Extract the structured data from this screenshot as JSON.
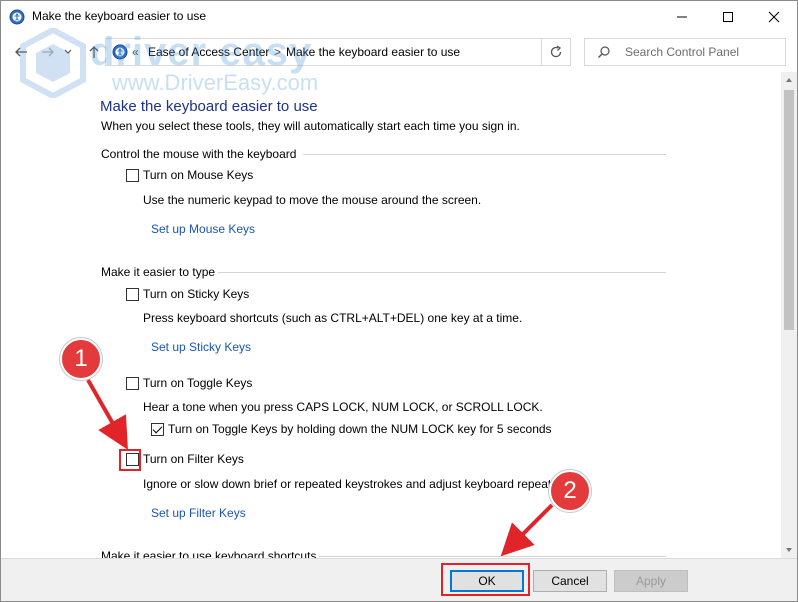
{
  "window": {
    "title": "Make the keyboard easier to use"
  },
  "nav": {
    "address_overflow": "«",
    "breadcrumbs": [
      "Ease of Access Center",
      "Make the keyboard easier to use"
    ],
    "breadcrumb_sep": ">",
    "search_placeholder": "Search Control Panel"
  },
  "page": {
    "title": "Make the keyboard easier to use",
    "subtitle": "When you select these tools, they will automatically start each time you sign in."
  },
  "sections": {
    "mouse": {
      "heading": "Control the mouse with the keyboard",
      "mouse_keys": {
        "label": "Turn on Mouse Keys",
        "checked": false
      },
      "mouse_keys_desc": "Use the numeric keypad to move the mouse around the screen.",
      "mouse_keys_link": "Set up Mouse Keys"
    },
    "typing": {
      "heading": "Make it easier to type",
      "sticky_keys": {
        "label": "Turn on Sticky Keys",
        "checked": false
      },
      "sticky_keys_desc": "Press keyboard shortcuts (such as CTRL+ALT+DEL) one key at a time.",
      "sticky_keys_link": "Set up Sticky Keys",
      "toggle_keys": {
        "label": "Turn on Toggle Keys",
        "checked": false
      },
      "toggle_keys_desc": "Hear a tone when you press CAPS LOCK, NUM LOCK, or SCROLL LOCK.",
      "toggle_keys_hold": {
        "label": "Turn on Toggle Keys by holding down the NUM LOCK key for 5 seconds",
        "checked": true
      },
      "filter_keys": {
        "label": "Turn on Filter Keys",
        "checked": false
      },
      "filter_keys_desc": "Ignore or slow down brief or repeated keystrokes and adjust keyboard repeat r",
      "filter_keys_link": "Set up Filter Keys"
    },
    "shortcuts": {
      "heading": "Make it easier to use keyboard shortcuts"
    }
  },
  "footer": {
    "ok": "OK",
    "cancel": "Cancel",
    "apply": "Apply"
  },
  "annotations": {
    "badge1": "1",
    "badge2": "2"
  },
  "watermark": {
    "brand": "driver easy",
    "url": "www.DriverEasy.com"
  },
  "colors": {
    "title_blue": "#1e3287",
    "link_blue": "#1a55b5",
    "annotation_red": "#e0242a",
    "badge_red": "#e33b3b"
  }
}
